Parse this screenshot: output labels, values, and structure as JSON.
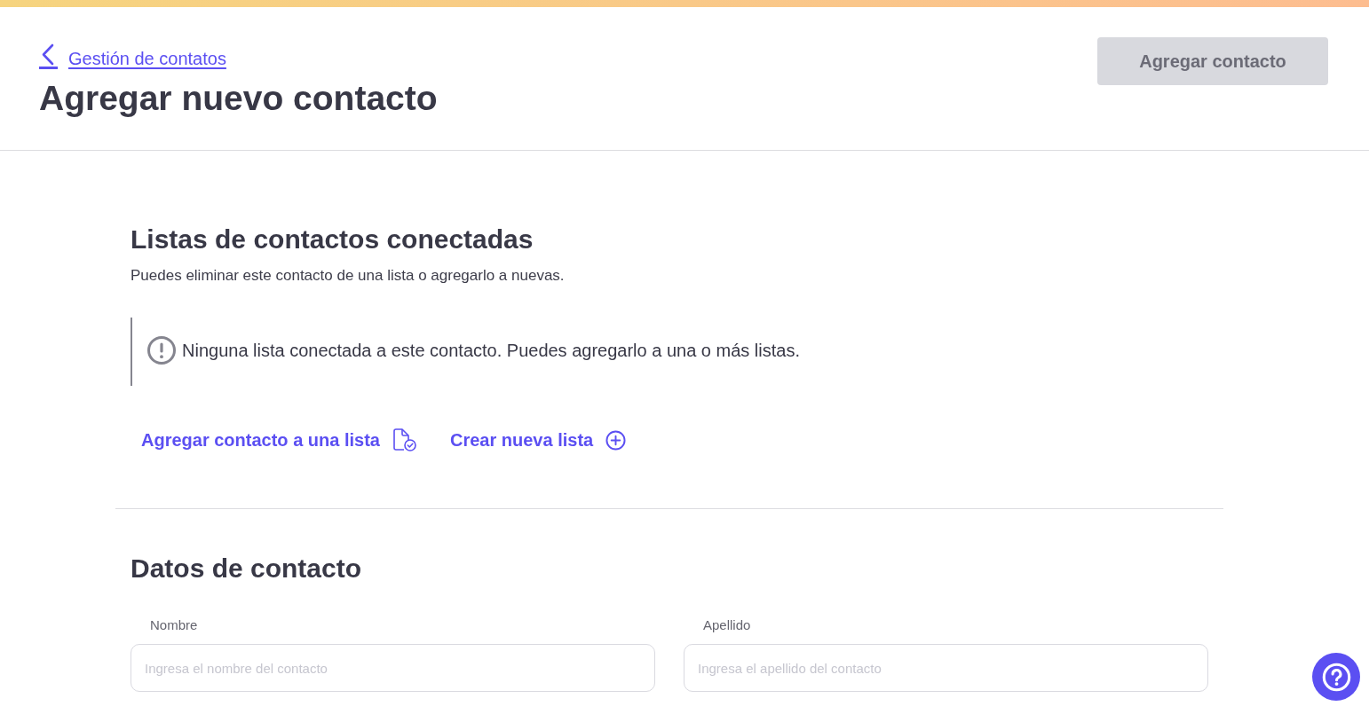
{
  "header": {
    "back_link": "Gestión de contatos",
    "title": "Agregar nuevo contacto",
    "primary_button": {
      "label": "Agregar contacto",
      "disabled": true
    }
  },
  "lists_section": {
    "title": "Listas de contactos conectadas",
    "description": "Puedes eliminar este contacto de una lista o agregarlo a nuevas.",
    "notice": "Ninguna lista conectada a este contacto. Puedes agregarlo a una o más listas.",
    "actions": [
      {
        "label": "Agregar contacto a una lista",
        "kind": "add-to-list"
      },
      {
        "label": "Crear nueva lista",
        "kind": "create"
      }
    ]
  },
  "contact_section": {
    "title": "Datos de contacto",
    "fields": [
      {
        "label": "Nombre",
        "placeholder": "Ingresa el nombre del contacto"
      },
      {
        "label": "Apellido",
        "placeholder": "Ingresa el apellido del contacto"
      }
    ]
  }
}
